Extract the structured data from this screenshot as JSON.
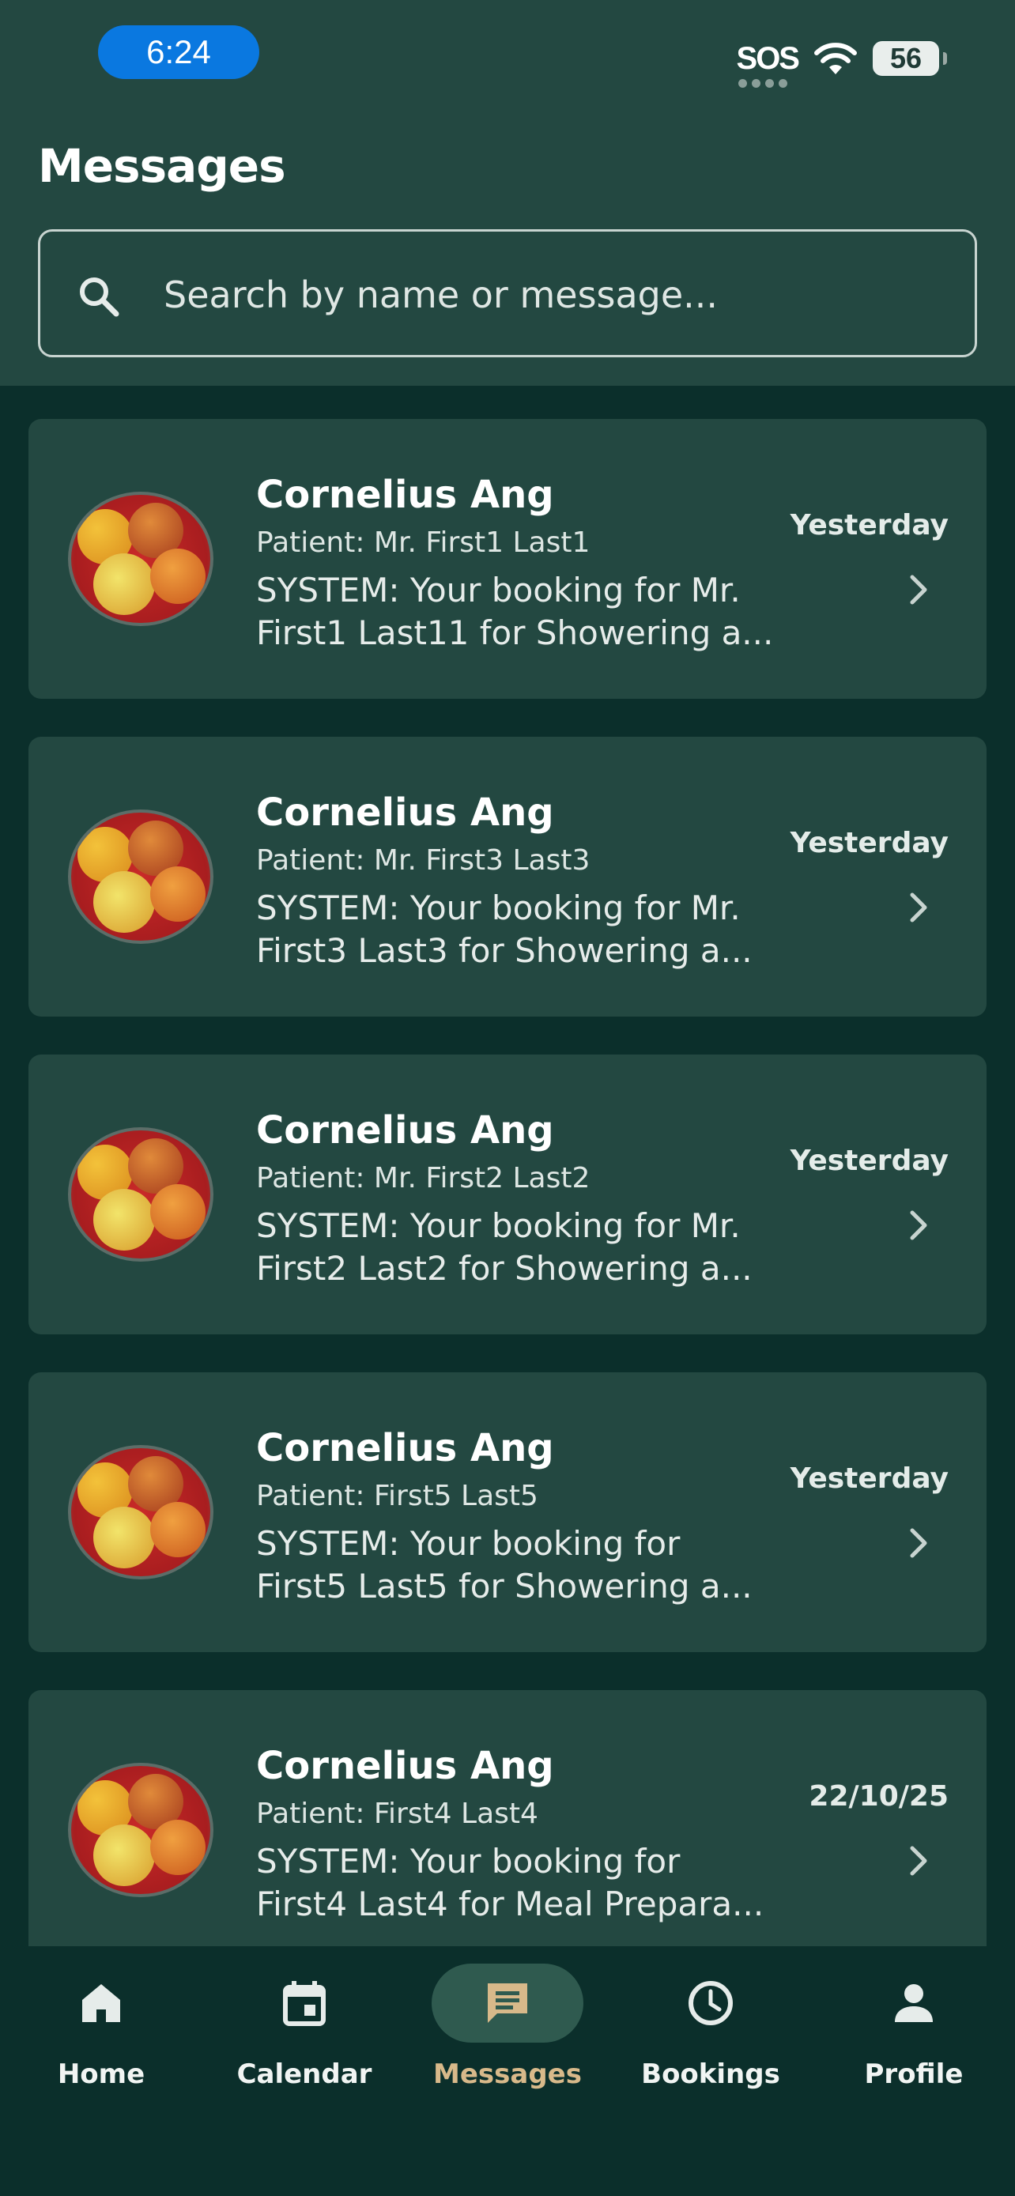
{
  "status_bar": {
    "time": "6:24",
    "sos": "SOS",
    "battery": "56"
  },
  "header": {
    "title": "Messages"
  },
  "search": {
    "placeholder": "Search by name or message..."
  },
  "conversations": [
    {
      "name": "Cornelius Ang",
      "patient": "Patient: Mr. First1 Last1",
      "preview_line1": "SYSTEM: Your booking for Mr.",
      "preview_line2": "First1 Last11 for Showering a...",
      "time": "Yesterday"
    },
    {
      "name": "Cornelius Ang",
      "patient": "Patient: Mr. First3 Last3",
      "preview_line1": "SYSTEM: Your booking for Mr.",
      "preview_line2": "First3 Last3 for Showering a...",
      "time": "Yesterday"
    },
    {
      "name": "Cornelius Ang",
      "patient": "Patient: Mr. First2 Last2",
      "preview_line1": "SYSTEM: Your booking for Mr.",
      "preview_line2": "First2 Last2 for Showering a...",
      "time": "Yesterday"
    },
    {
      "name": "Cornelius Ang",
      "patient": "Patient: First5 Last5",
      "preview_line1": "SYSTEM: Your booking for",
      "preview_line2": "First5 Last5 for Showering a...",
      "time": "Yesterday"
    },
    {
      "name": "Cornelius Ang",
      "patient": "Patient: First4 Last4",
      "preview_line1": "SYSTEM: Your booking for",
      "preview_line2": "First4 Last4 for Meal Prepara...",
      "time": "22/10/25"
    }
  ],
  "nav": {
    "items": [
      {
        "label": "Home",
        "icon": "home-icon"
      },
      {
        "label": "Calendar",
        "icon": "calendar-icon"
      },
      {
        "label": "Messages",
        "icon": "message-icon",
        "active": true
      },
      {
        "label": "Bookings",
        "icon": "clock-icon"
      },
      {
        "label": "Profile",
        "icon": "person-icon"
      }
    ]
  },
  "colors": {
    "header_bg": "#234841",
    "page_bg": "#0b2f2b",
    "card_bg": "#234841",
    "active_nav": "#d8b98a",
    "time_pill": "#0a78e0"
  }
}
